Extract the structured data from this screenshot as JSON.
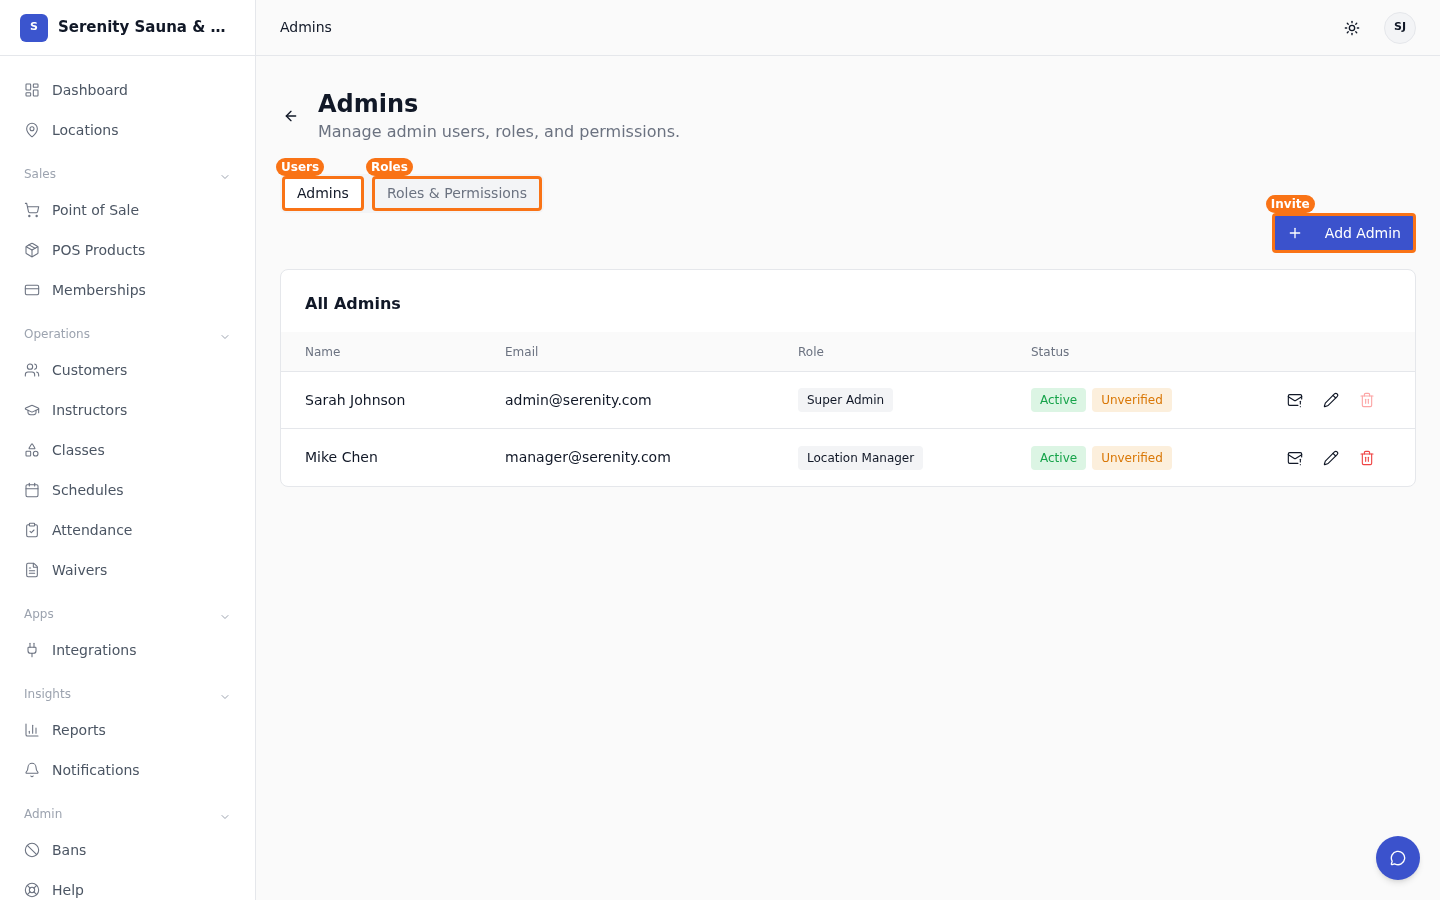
{
  "brand": {
    "initial": "S",
    "name": "Serenity Sauna & …"
  },
  "sidebar": {
    "top_items": [
      {
        "label": "Dashboard"
      },
      {
        "label": "Locations"
      }
    ],
    "sections": [
      {
        "label": "Sales",
        "expanded": true,
        "items": [
          {
            "label": "Point of Sale"
          },
          {
            "label": "POS Products"
          },
          {
            "label": "Memberships"
          }
        ]
      },
      {
        "label": "Operations",
        "expanded": true,
        "items": [
          {
            "label": "Customers"
          },
          {
            "label": "Instructors"
          },
          {
            "label": "Classes"
          },
          {
            "label": "Schedules"
          },
          {
            "label": "Attendance"
          },
          {
            "label": "Waivers"
          }
        ]
      },
      {
        "label": "Apps",
        "expanded": true,
        "items": [
          {
            "label": "Integrations"
          }
        ]
      },
      {
        "label": "Insights",
        "expanded": true,
        "items": [
          {
            "label": "Reports"
          },
          {
            "label": "Notifications"
          }
        ]
      },
      {
        "label": "Admin",
        "expanded": true,
        "items": [
          {
            "label": "Bans"
          },
          {
            "label": "Help"
          }
        ]
      }
    ]
  },
  "header": {
    "title": "Admins",
    "avatar": "SJ"
  },
  "page": {
    "title": "Admins",
    "subtitle": "Manage admin users, roles, and permissions."
  },
  "tabs": [
    {
      "label": "Admins",
      "selected": true,
      "tag": "Users"
    },
    {
      "label": "Roles & Permissions",
      "selected": false,
      "tag": "Roles"
    }
  ],
  "add_button": {
    "label": "Add Admin",
    "tag": "Invite"
  },
  "table": {
    "title": "All Admins",
    "columns": [
      "Name",
      "Email",
      "Role",
      "Status"
    ],
    "rows": [
      {
        "name": "Sarah Johnson",
        "email": "admin@serenity.com",
        "role": "Super Admin",
        "statuses": [
          {
            "label": "Active",
            "kind": "active"
          },
          {
            "label": "Unverified",
            "kind": "unverified"
          }
        ],
        "delete_disabled": true
      },
      {
        "name": "Mike Chen",
        "email": "manager@serenity.com",
        "role": "Location Manager",
        "statuses": [
          {
            "label": "Active",
            "kind": "active"
          },
          {
            "label": "Unverified",
            "kind": "unverified"
          }
        ],
        "delete_disabled": false
      }
    ]
  }
}
